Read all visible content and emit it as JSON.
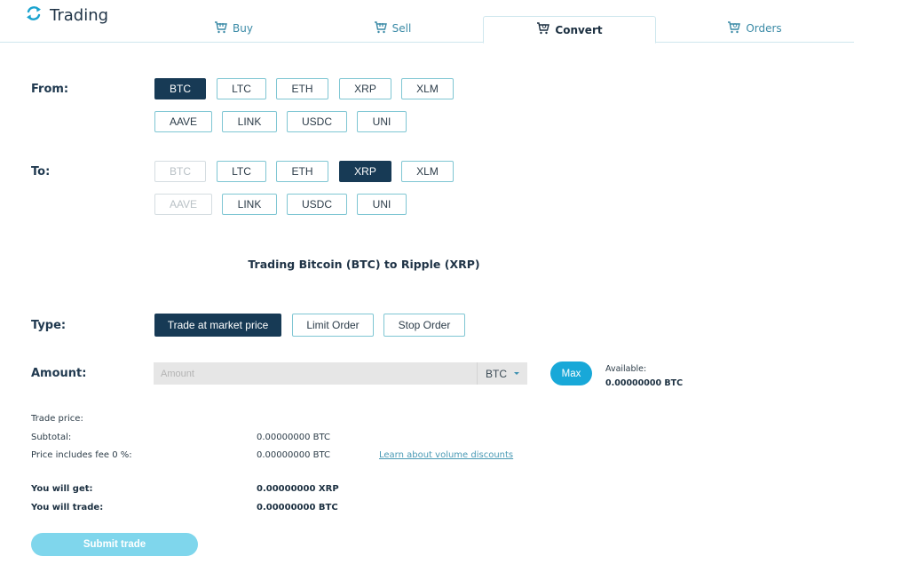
{
  "header": {
    "title": "Trading",
    "logo_icon": "refresh-cycle-icon"
  },
  "tabs": [
    {
      "label": "Buy",
      "icon": "cart-icon",
      "active": false
    },
    {
      "label": "Sell",
      "icon": "cart-icon",
      "active": false
    },
    {
      "label": "Convert",
      "icon": "cart-icon",
      "active": true
    },
    {
      "label": "Orders",
      "icon": "cart-icon",
      "active": false
    }
  ],
  "from": {
    "label": "From:",
    "options": [
      "BTC",
      "LTC",
      "ETH",
      "XRP",
      "XLM",
      "AAVE",
      "LINK",
      "USDC",
      "UNI"
    ],
    "selected": "BTC"
  },
  "to": {
    "label": "To:",
    "options": [
      "BTC",
      "LTC",
      "ETH",
      "XRP",
      "XLM",
      "AAVE",
      "LINK",
      "USDC",
      "UNI"
    ],
    "selected": "XRP",
    "disabled": [
      "BTC",
      "AAVE"
    ]
  },
  "trade_title": "Trading Bitcoin (BTC) to Ripple (XRP)",
  "type": {
    "label": "Type:",
    "options": [
      "Trade at market price",
      "Limit Order",
      "Stop Order"
    ],
    "selected": "Trade at market price"
  },
  "amount": {
    "label": "Amount:",
    "placeholder": "Amount",
    "value": "",
    "currency": "BTC",
    "max_label": "Max",
    "available_label": "Available:",
    "available_value": "0.00000000 BTC"
  },
  "summary": {
    "trade_price_label": "Trade price:",
    "trade_price_value": "",
    "subtotal_label": "Subtotal:",
    "subtotal_value": "0.00000000 BTC",
    "fee_label": "Price includes fee 0 %:",
    "fee_value": "0.00000000 BTC",
    "discount_link": "Learn about volume discounts",
    "get_label": "You will get:",
    "get_value": "0.00000000 XRP",
    "trade_label": "You will trade:",
    "trade_value": "0.00000000 BTC"
  },
  "submit_label": "Submit trade",
  "colors": {
    "primary": "#173a55",
    "accent": "#18a8d8",
    "border": "#7fc6d3",
    "submit_disabled": "#7fd6ec"
  }
}
